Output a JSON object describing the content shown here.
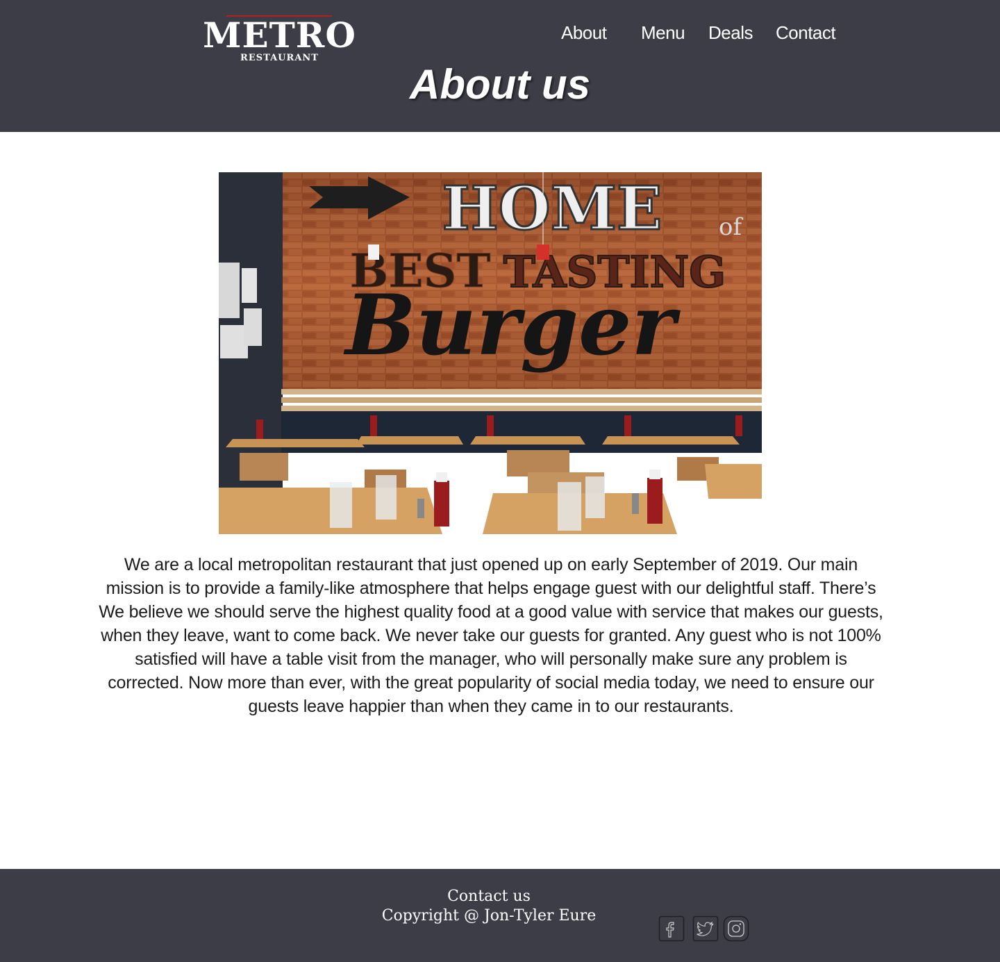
{
  "header": {
    "logo": {
      "main": "METRO",
      "sub": "RESTAURANT",
      "accent_color": "#b3201f"
    },
    "nav": [
      {
        "label": "About"
      },
      {
        "label": "Menu"
      },
      {
        "label": "Deals"
      },
      {
        "label": "Contact"
      }
    ],
    "background": "#3c3d46"
  },
  "page_title": "About us",
  "hero_image": {
    "wall_text": [
      "HOME",
      "of",
      "BEST",
      "TASTING",
      "Burger"
    ]
  },
  "about": {
    "paragraph": "We are a local metropolitan restaurant that just opened up on early September of 2019.  Our main mission is to provide a family-like atmosphere that helps engage guest with our delightful staff. There’s We believe we should serve the highest quality food at a good value with service that makes our guests, when they leave, want to come back. We never take our guests for granted. Any guest who is not 100% satisfied will have a table visit from the manager, who will personally make sure any problem is corrected. Now more than ever, with the great popularity of social media today, we need to ensure our guests leave happier than when they came in to our restaurants."
  },
  "footer": {
    "contact_label": "Contact us",
    "copyright": "Copyright @ Jon-Tyler Eure",
    "social_icons": [
      "facebook-icon",
      "twitter-icon",
      "instagram-icon"
    ]
  }
}
